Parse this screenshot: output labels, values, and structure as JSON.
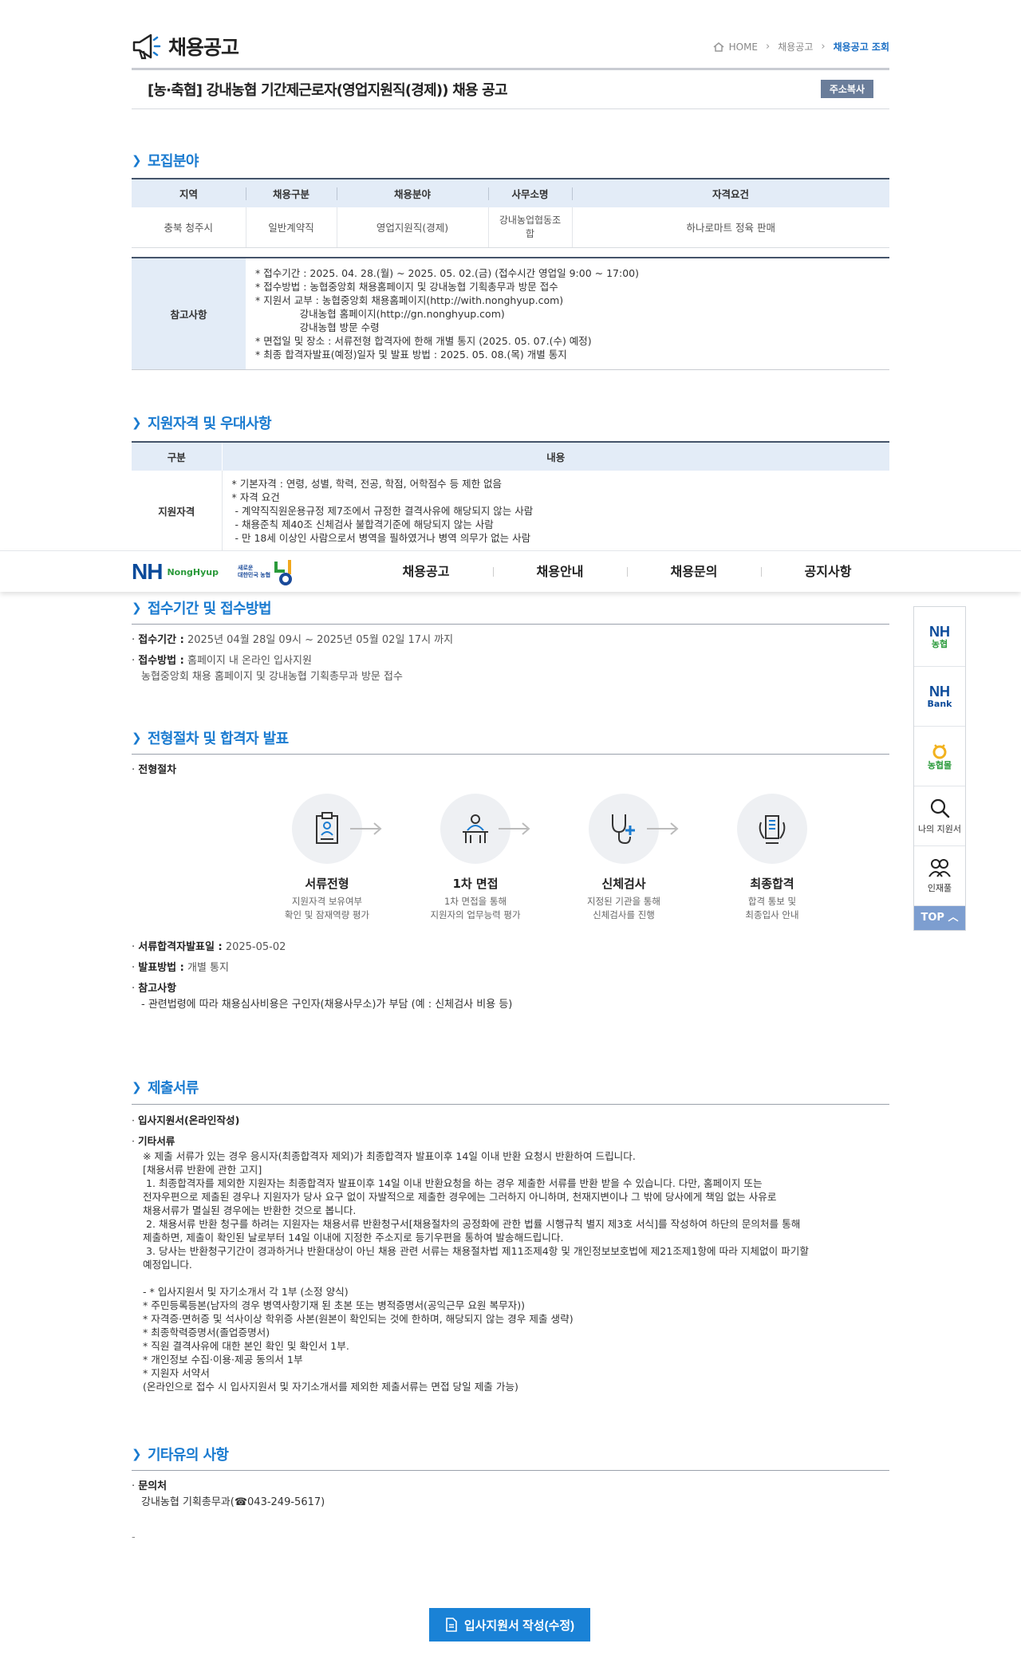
{
  "header": {
    "title": "채용공고",
    "breadcrumb": [
      "HOME",
      "채용공고",
      "채용공고 조회"
    ]
  },
  "post": {
    "title": "[농·축협] 강내농협 기간제근로자(영업지원직(경제)) 채용 공고",
    "copy_label": "주소복사"
  },
  "recruit": {
    "section_title": "모집분야",
    "headers": [
      "지역",
      "채용구분",
      "채용분야",
      "사무소명",
      "자격요건"
    ],
    "row": [
      "충북 청주시",
      "일반계약직",
      "영업지원직(경제)",
      "강내농업협동조\n합",
      "하나로마트 정육 판매"
    ],
    "ref_label": "참고사항",
    "ref_lines": [
      "* 접수기간 : 2025. 04. 28.(월) ~ 2025. 05. 02.(금) (접수시간 영업일 9:00 ~ 17:00)",
      "* 접수방법 : 농협중앙회 채용홈페이지 및 강내농협 기획총무과 방문 접수",
      "* 지원서 교부 : 농협중앙회 채용홈페이지(http://with.nonghyup.com)",
      "              강내농협 홈페이지(http://gn.nonghyup.com)",
      "              강내농협 방문 수령",
      "* 면접일 및 장소 : 서류전형 합격자에 한해 개별 통지 (2025. 05. 07.(수) 예정)",
      "* 최종 합격자발표(예정)일자 및 발표 방법 : 2025. 05. 08.(목) 개별 통지"
    ]
  },
  "qualification": {
    "section_title": "지원자격 및 우대사항",
    "headers": [
      "구분",
      "내용"
    ],
    "row_label": "지원자격",
    "lines": [
      "* 기본자격 : 연령, 성별, 학력, 전공, 학점, 어학점수 등 제한 없음",
      "* 자격 요건",
      " - 계약직직원운용규정 제7조에서 규정한 결격사유에 해당되지 않는 사람",
      " - 채용준칙 제40조 신체검사 불합격기준에 해당되지 않는 사람",
      " - 만 18세 이상인 사람으로서 병역을 필하였거나 병역 의무가 없는 사람"
    ]
  },
  "nav": {
    "logo_nh": "NH",
    "logo_text": "NongHyup",
    "logo_sub": [
      "새로운",
      "대한민국 농협"
    ],
    "items": [
      "채용공고",
      "채용안내",
      "채용문의",
      "공지사항"
    ]
  },
  "side": {
    "items": [
      {
        "big": "NH",
        "small": "농협"
      },
      {
        "big": "NH",
        "small": "Bank"
      },
      {
        "big": "",
        "small": "농협몰"
      },
      {
        "big": "",
        "small": "나의 지원서"
      },
      {
        "big": "",
        "small": "인재풀"
      }
    ],
    "top_label": "TOP"
  },
  "period": {
    "section_title": "접수기간 및 접수방법",
    "period_label": "접수기간 :",
    "period_value": "2025년 04월 28일 09시 ~ 2025년 05월 02일 17시 까지",
    "method_label": "접수방법 :",
    "method_value": "홈페이지 내 온라인 입사지원",
    "method_extra": "농협중앙회 채용 홈페이지 및 강내농협 기획총무과 방문 접수"
  },
  "process": {
    "section_title": "전형절차 및 합격자 발표",
    "sub_label": "전형절차",
    "steps": [
      {
        "name": "서류전형",
        "desc1": "지원자격 보유여부",
        "desc2": "확인 및 잠재역량 평가"
      },
      {
        "name": "1차 면접",
        "desc1": "1차 면접을 통해",
        "desc2": "지원자의 업무능력 평가"
      },
      {
        "name": "신체검사",
        "desc1": "지정된 기관을 통해",
        "desc2": "신체검사를 진행"
      },
      {
        "name": "최종합격",
        "desc1": "합격 통보 및",
        "desc2": "최종입사 안내"
      }
    ],
    "doc_pass_label": "서류합격자발표일 :",
    "doc_pass_value": "2025-05-02",
    "announce_label": "발표방법 :",
    "announce_value": "개별 통지",
    "note_label": "참고사항",
    "note_value": "- 관련법령에 따라 채용심사비용은 구인자(채용사무소)가 부담 (예 : 신체검사 비용 등)"
  },
  "documents": {
    "section_title": "제출서류",
    "item1": "입사지원서(온라인작성)",
    "item2": "기타서류",
    "lines": [
      "※ 제출 서류가 있는 경우 응시자(최종합격자 제외)가 최종합격자 발표이후 14일 이내 반환 요청시 반환하여 드립니다.",
      "[채용서류 반환에 관한 고지]",
      " 1. 최종합격자를 제외한 지원자는 최종합격자 발표이후 14일 이내 반환요청을 하는 경우 제출한 서류를 반환 받을 수 있습니다. 다만, 홈페이지 또는",
      "전자우편으로 제출된 경우나 지원자가 당사 요구 없이 자발적으로 제출한 경우에는 그러하지 아니하며, 천재지변이나 그 밖에 당사에게 책임 없는 사유로",
      "채용서류가 멸실된 경우에는 반환한 것으로 봅니다.",
      " 2. 채용서류 반환 청구를 하려는 지원자는 채용서류 반환청구서[채용절차의 공정화에 관한 법률 시행규칙 별지 제3호 서식]를 작성하여 하단의 문의처를 통해",
      "제출하면, 제출이 확인된 날로부터 14일 이내에 지정한 주소지로 등기우편을 통하여 발송해드립니다.",
      " 3. 당사는 반환청구기간이 경과하거나 반환대상이 아닌 채용 관련 서류는 채용절차법 제11조제4항 및 개인정보보호법에 제21조제1항에 따라 지체없이 파기할",
      "예정입니다.",
      "",
      "- * 입사지원서 및 자기소개서 각 1부 (소정 양식)",
      "* 주민등록등본(남자의 경우 병역사항기재 된 초본 또는 병적증명서(공익근무 요원 복무자))",
      "* 자격증·면허증 및 석사이상 학위증 사본(원본이 확인되는 것에 한하며, 해당되지 않는 경우 제출 생략)",
      "* 최종학력증명서(졸업증명서)",
      "* 직원 결격사유에 대한 본인 확인 및 확인서 1부.",
      "* 개인정보 수집·이용·제공 동의서 1부",
      "* 지원자 서약서",
      "(온라인으로 접수 시 입사지원서 및 자기소개서를 제외한 제출서류는 면접 당일 제출 가능)"
    ]
  },
  "etc": {
    "section_title": "기타유의 사항",
    "contact_label": "문의처",
    "contact_value": "강내농협 기획총무과(☎043-249-5617)",
    "dash": "-"
  },
  "apply_button": "입사지원서 작성(수정)"
}
